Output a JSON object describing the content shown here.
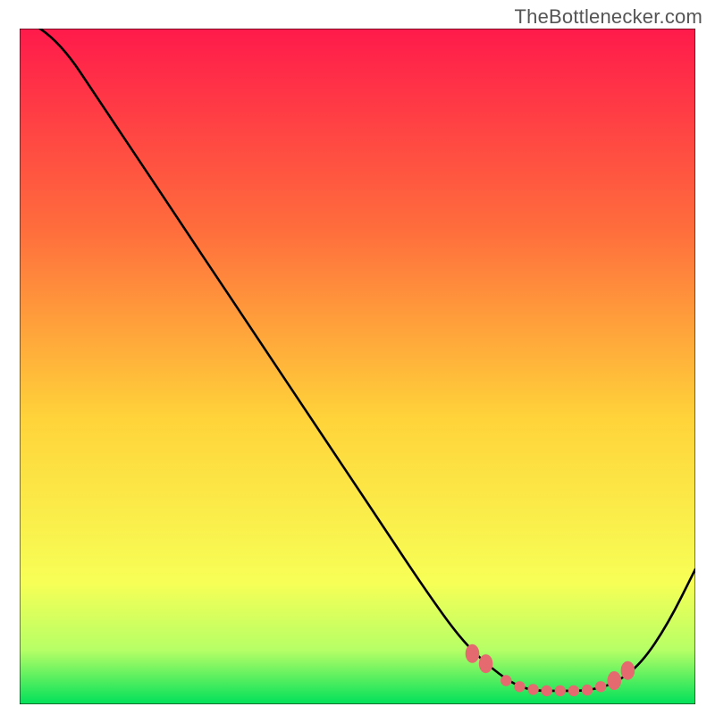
{
  "attribution": "TheBottlenecker.com",
  "colors": {
    "gradient_top": "#ff1a4b",
    "gradient_mid1": "#ff6e3c",
    "gradient_mid2": "#ffd43a",
    "gradient_low": "#f7ff56",
    "gradient_band": "#b6ff66",
    "gradient_bottom": "#00e05a",
    "curve": "#000000",
    "marker": "#e46a6f",
    "border": "#000000"
  },
  "chart_data": {
    "type": "line",
    "title": "",
    "xlabel": "",
    "ylabel": "",
    "xlim": [
      0,
      100
    ],
    "ylim": [
      0,
      100
    ],
    "series": [
      {
        "name": "bottleneck-curve",
        "x": [
          0,
          6,
          12,
          18,
          24,
          30,
          36,
          42,
          48,
          54,
          60,
          65,
          69,
          73,
          76,
          80,
          84,
          88,
          92,
          96,
          100
        ],
        "values": [
          102,
          98,
          89,
          80,
          71,
          62,
          53,
          44,
          35,
          26,
          17,
          10,
          6,
          3,
          2,
          2,
          2,
          3,
          6,
          12,
          20
        ]
      }
    ],
    "markers": {
      "name": "optimal-zone",
      "points": [
        {
          "x": 67,
          "y": 7.5
        },
        {
          "x": 69,
          "y": 6
        },
        {
          "x": 72,
          "y": 3.5
        },
        {
          "x": 74,
          "y": 2.6
        },
        {
          "x": 76,
          "y": 2.2
        },
        {
          "x": 78,
          "y": 2
        },
        {
          "x": 80,
          "y": 2
        },
        {
          "x": 82,
          "y": 2
        },
        {
          "x": 84,
          "y": 2.1
        },
        {
          "x": 86,
          "y": 2.6
        },
        {
          "x": 88,
          "y": 3.5
        },
        {
          "x": 90,
          "y": 5
        }
      ]
    }
  }
}
